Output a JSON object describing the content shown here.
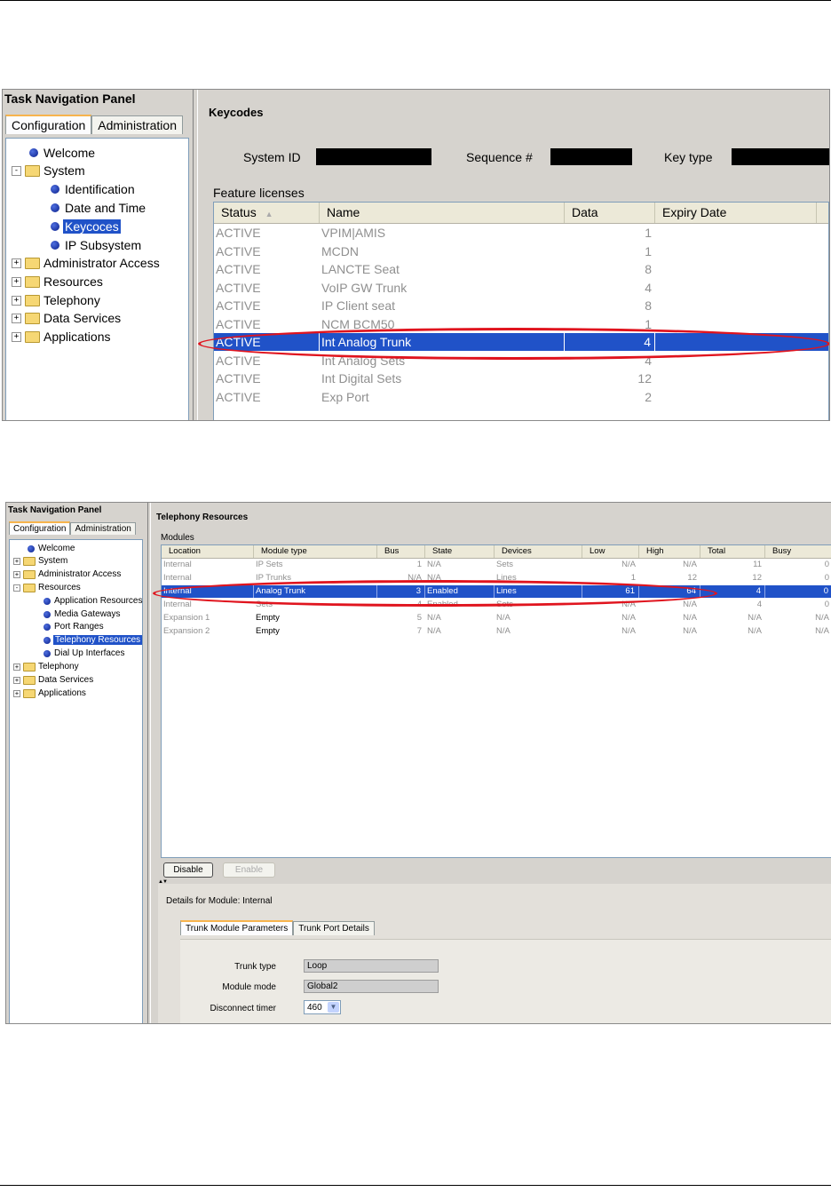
{
  "shot1": {
    "panel_title": "Task Navigation Panel",
    "tabs": [
      "Configuration",
      "Administration"
    ],
    "tree": {
      "welcome": "Welcome",
      "system": "System",
      "identification": "Identification",
      "date_time": "Date and Time",
      "keycodes": "Keycoces",
      "ip_subsystem": "IP Subsystem",
      "admin_access": "Administrator Access",
      "resources": "Resources",
      "telephony": "Telephony",
      "data_services": "Data Services",
      "applications": "Applications"
    },
    "heading": "Keycodes",
    "system_id_label": "System ID",
    "sequence_label": "Sequence #",
    "key_type_label": "Key type",
    "feature_licenses_label": "Feature licenses",
    "columns": [
      "Status",
      "Name",
      "Data",
      "Expiry Date"
    ],
    "sort_indicator": "▲",
    "rows": [
      {
        "status": "ACTIVE",
        "name": "VPIM|AMIS",
        "data": "1",
        "expiry": ""
      },
      {
        "status": "ACTIVE",
        "name": "MCDN",
        "data": "1",
        "expiry": ""
      },
      {
        "status": "ACTIVE",
        "name": "LANCTE Seat",
        "data": "8",
        "expiry": ""
      },
      {
        "status": "ACTIVE",
        "name": "VoIP GW Trunk",
        "data": "4",
        "expiry": ""
      },
      {
        "status": "ACTIVE",
        "name": "IP Client seat",
        "data": "8",
        "expiry": ""
      },
      {
        "status": "ACTIVE",
        "name": "NCM BCM50",
        "data": "1",
        "expiry": ""
      },
      {
        "status": "ACTIVE",
        "name": "Int Analog Trunk",
        "data": "4",
        "expiry": ""
      },
      {
        "status": "ACTIVE",
        "name": "Int Analog Sets",
        "data": "4",
        "expiry": ""
      },
      {
        "status": "ACTIVE",
        "name": "Int Digital Sets",
        "data": "12",
        "expiry": ""
      },
      {
        "status": "ACTIVE",
        "name": "Exp Port",
        "data": "2",
        "expiry": ""
      }
    ]
  },
  "shot2": {
    "panel_title": "Task Navigation Panel",
    "tabs": [
      "Configuration",
      "Administration"
    ],
    "tree": {
      "welcome": "Welcome",
      "system": "System",
      "admin_access": "Administrator Access",
      "resources": "Resources",
      "app_resources": "Application Resources",
      "media_gateways": "Media Gateways",
      "port_ranges": "Port Ranges",
      "telephony_resources": "Telephony Resources",
      "dial_up": "Dial Up Interfaces",
      "telephony": "Telephony",
      "data_services": "Data Services",
      "applications": "Applications"
    },
    "heading": "Telephony Resources",
    "modules_label": "Modules",
    "columns": [
      "Location",
      "Module type",
      "Bus",
      "State",
      "Devices",
      "Low",
      "High",
      "Total",
      "Busy"
    ],
    "rows": [
      {
        "location": "Internal",
        "type": "IP Sets",
        "bus": "1",
        "state": "N/A",
        "devices": "Sets",
        "low": "N/A",
        "high": "N/A",
        "total": "11",
        "busy": "0"
      },
      {
        "location": "Internal",
        "type": "IP Trunks",
        "bus": "N/A",
        "state": "N/A",
        "devices": "Lines",
        "low": "1",
        "high": "12",
        "total": "12",
        "busy": "0"
      },
      {
        "location": "Internal",
        "type": "Analog Trunk",
        "bus": "3",
        "state": "Enabled",
        "devices": "Lines",
        "low": "61",
        "high": "64",
        "total": "4",
        "busy": "0"
      },
      {
        "location": "Internal",
        "type": "Sets",
        "bus": "4",
        "state": "Enabled",
        "devices": "Sets",
        "low": "N/A",
        "high": "N/A",
        "total": "4",
        "busy": "0"
      },
      {
        "location": "Expansion 1",
        "type": "Empty",
        "bus": "5",
        "state": "N/A",
        "devices": "N/A",
        "low": "N/A",
        "high": "N/A",
        "total": "N/A",
        "busy": "N/A"
      },
      {
        "location": "Expansion 2",
        "type": "Empty",
        "bus": "7",
        "state": "N/A",
        "devices": "N/A",
        "low": "N/A",
        "high": "N/A",
        "total": "N/A",
        "busy": "N/A"
      }
    ],
    "disable_btn": "Disable",
    "enable_btn": "Enable",
    "details_label": "Details for Module: Internal",
    "detail_tabs": [
      "Trunk Module Parameters",
      "Trunk Port Details"
    ],
    "trunk_type_label": "Trunk type",
    "trunk_type_value": "Loop",
    "module_mode_label": "Module mode",
    "module_mode_value": "Global2",
    "disconnect_label": "Disconnect timer",
    "disconnect_value": "460",
    "splitter_arrows": "▲▼"
  },
  "colors": {
    "selection": "#2052c8",
    "annotation": "#e0141e"
  }
}
